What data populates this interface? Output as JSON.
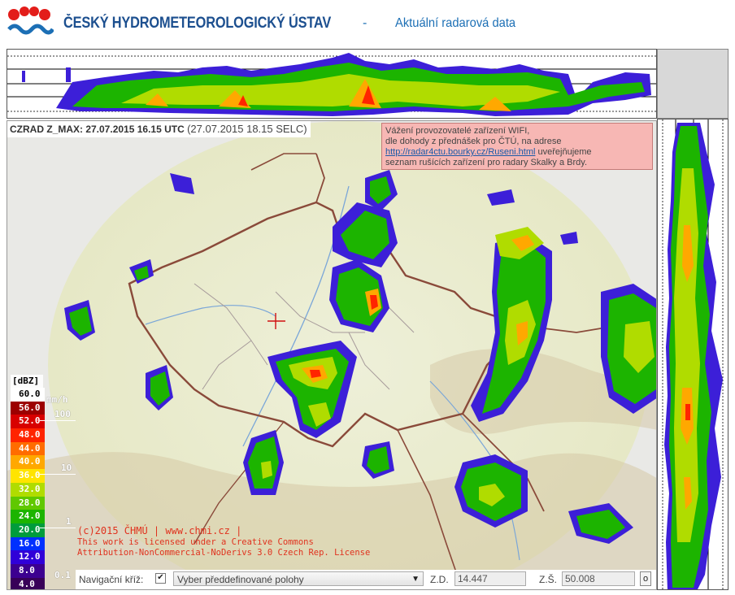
{
  "header": {
    "org_name": "ČESKÝ HYDROMETEOROLOGICKÝ ÚSTAV",
    "separator": "-",
    "page_title": "Aktuální radarová data"
  },
  "map": {
    "title_bold": "CZRAD Z_MAX: 27.07.2015 16.15 UTC",
    "title_local": "(27.07.2015 18.15 SELC)",
    "notice": {
      "line1": "Vážení provozovatelé zařízení WIFI,",
      "line2": "dle dohody z přednášek pro ČTÚ, na adrese",
      "link": "http://radar4ctu.bourky.cz/Ruseni.html",
      "line3_rest": "uveřejňujeme",
      "line4": "seznam rušících zařízení pro radary Skalky a Brdy."
    },
    "copyright": {
      "line1": "(c)2015 ČHMÚ | www.chmi.cz |",
      "line2": "This work is licensed under a Creative Commons",
      "line3": "Attribution-NonCommercial-NoDerivs 3.0 Czech Rep. License"
    }
  },
  "legend": {
    "unit": "[dBZ]",
    "rate_unit": "mm/h",
    "levels": [
      {
        "value": "60.0",
        "color": "#ffffff",
        "text_color": "#000000"
      },
      {
        "value": "56.0",
        "color": "#9c0000",
        "text_color": "#ffffff"
      },
      {
        "value": "52.0",
        "color": "#d80000",
        "text_color": "#ffffff"
      },
      {
        "value": "48.0",
        "color": "#ff2400",
        "text_color": "#ffffff"
      },
      {
        "value": "44.0",
        "color": "#ff6c00",
        "text_color": "#ffffff"
      },
      {
        "value": "40.0",
        "color": "#ffa800",
        "text_color": "#ffffff"
      },
      {
        "value": "36.0",
        "color": "#ffe400",
        "text_color": "#ffffff"
      },
      {
        "value": "32.0",
        "color": "#b0dc00",
        "text_color": "#ffffff"
      },
      {
        "value": "28.0",
        "color": "#60c800",
        "text_color": "#ffffff"
      },
      {
        "value": "24.0",
        "color": "#1cb400",
        "text_color": "#ffffff"
      },
      {
        "value": "20.0",
        "color": "#009c3c",
        "text_color": "#ffffff"
      },
      {
        "value": "16.0",
        "color": "#0030ff",
        "text_color": "#ffffff"
      },
      {
        "value": "12.0",
        "color": "#3000d8",
        "text_color": "#ffffff"
      },
      {
        "value": "8.0",
        "color": "#3c0090",
        "text_color": "#ffffff"
      },
      {
        "value": "4.0",
        "color": "#380058",
        "text_color": "#ffffff"
      }
    ],
    "rates": [
      "100",
      "10",
      "1",
      "0.1"
    ]
  },
  "nav": {
    "cross_label": "Navigační kříž:",
    "cross_checked": true,
    "preset_placeholder": "Vyber předdefinované polohy",
    "zd_label": "Z.D.",
    "zd_value": "14.447",
    "zs_label": "Z.Š.",
    "zs_value": "50.008",
    "go_label": "o"
  },
  "colors": {
    "brand_blue": "#1c4f8f",
    "brand_red": "#e31d1a",
    "notice_bg": "#f7b7b4",
    "copyright_red": "#e0321e"
  }
}
